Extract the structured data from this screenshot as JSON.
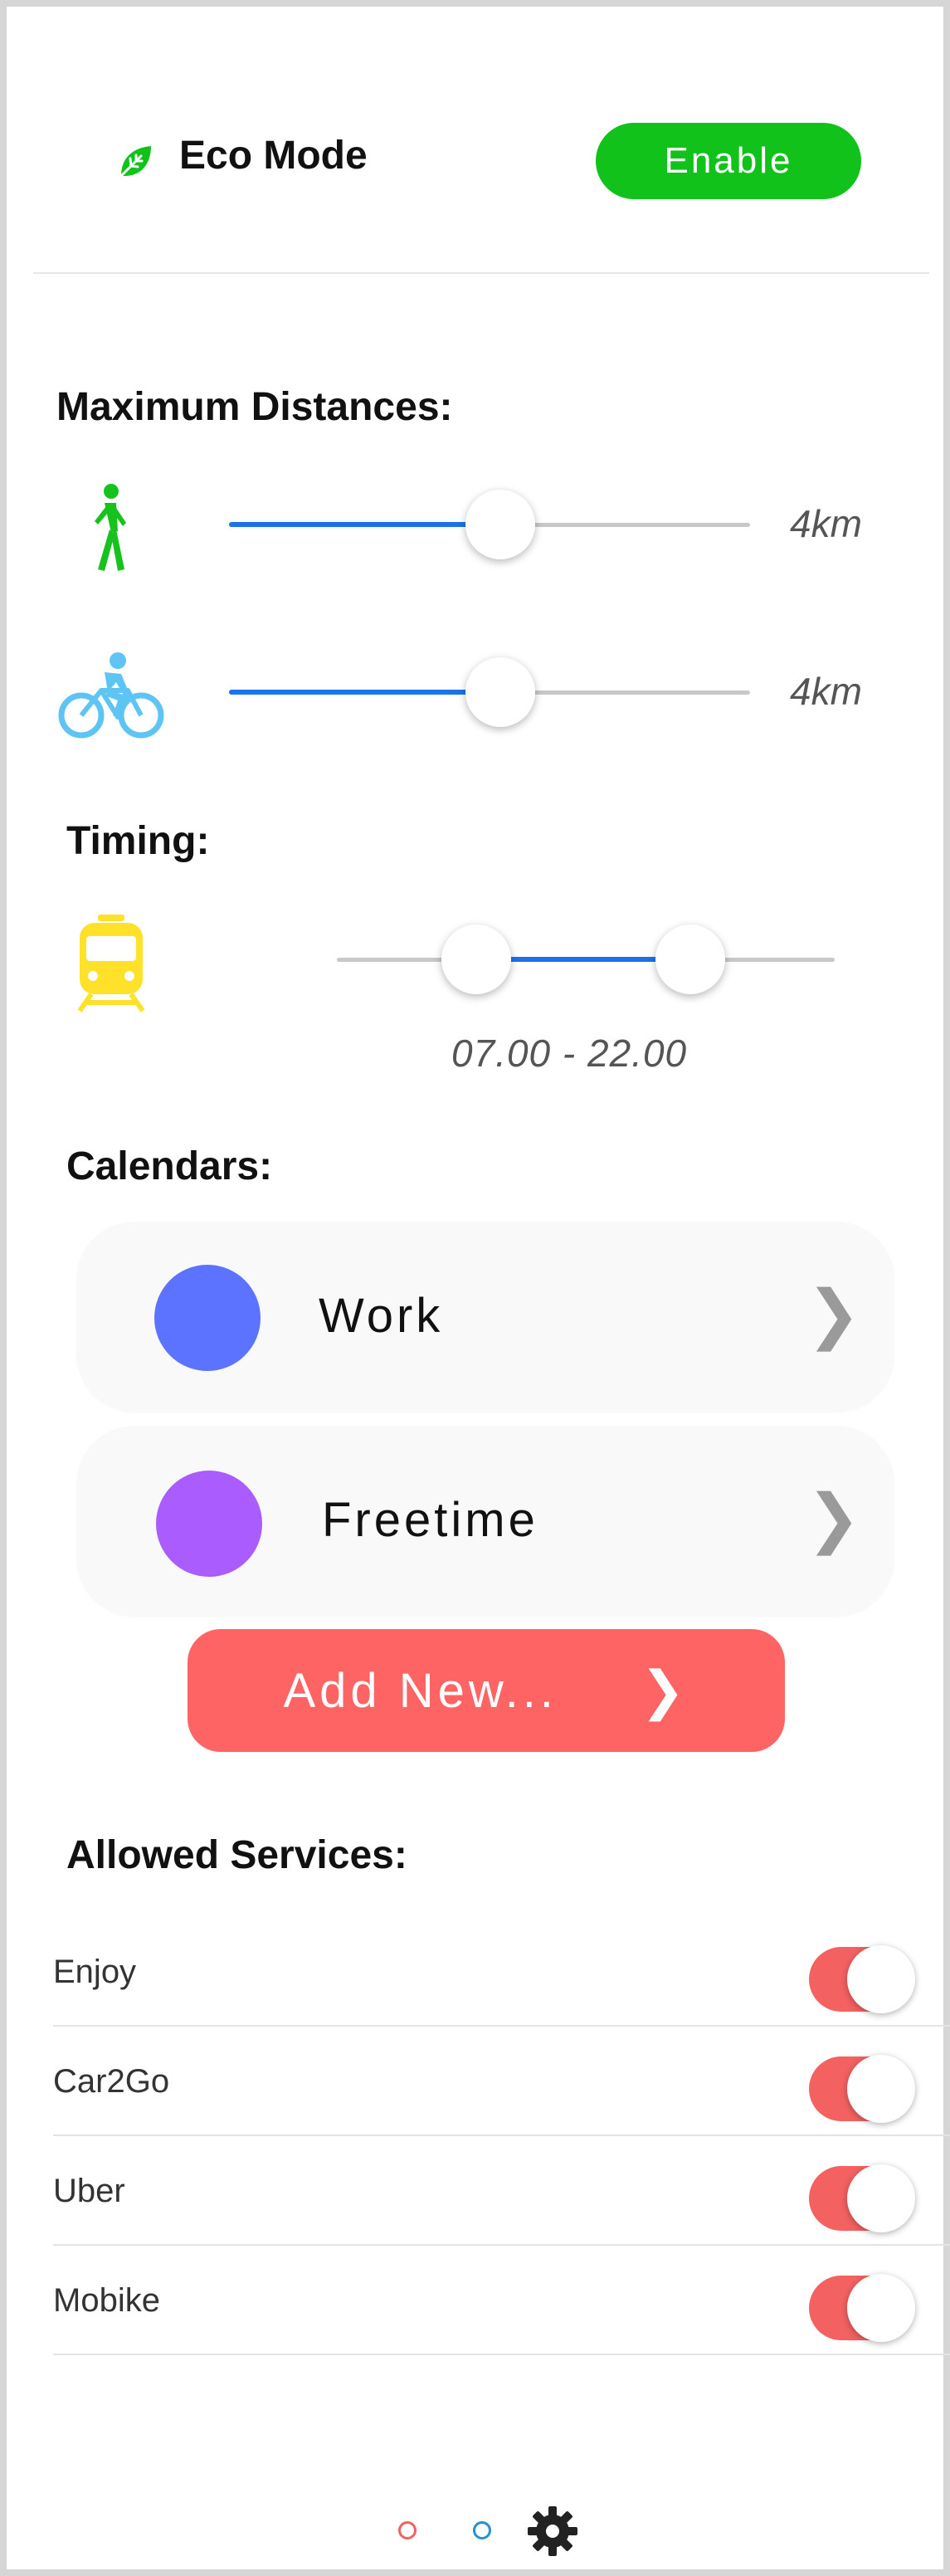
{
  "header": {
    "title": "Eco Mode",
    "icon": "leaf-icon",
    "enable_label": "Enable",
    "enable_color": "#10c21a"
  },
  "distances": {
    "title": "Maximum Distances:",
    "walk": {
      "icon": "walking-icon",
      "value_label": "4km",
      "level": 0.52
    },
    "bike": {
      "icon": "bicycle-icon",
      "value_label": "4km",
      "level": 0.52
    }
  },
  "timing": {
    "title": "Timing:",
    "icon": "train-icon",
    "range_label": "07.00 - 22.00",
    "range_start": 0.28,
    "range_end": 0.71
  },
  "calendars": {
    "title": "Calendars:",
    "items": [
      {
        "label": "Work",
        "color": "#5b73ff"
      },
      {
        "label": "Freetime",
        "color": "#aa5cff"
      }
    ],
    "add_label": "Add New...",
    "add_color": "#ff6464"
  },
  "services": {
    "title": "Allowed Services:",
    "items": [
      {
        "label": "Enjoy",
        "enabled": true
      },
      {
        "label": "Car2Go",
        "enabled": true
      },
      {
        "label": "Uber",
        "enabled": true
      },
      {
        "label": "Mobike",
        "enabled": true
      }
    ],
    "toggle_color": "#f36161"
  },
  "nav": {
    "dots": [
      {
        "name": "page-dot-1",
        "color": "#f36161"
      },
      {
        "name": "page-dot-2",
        "color": "#2a8fd0"
      }
    ],
    "settings_icon": "gear-icon"
  },
  "accent_color": "#1a73e8"
}
